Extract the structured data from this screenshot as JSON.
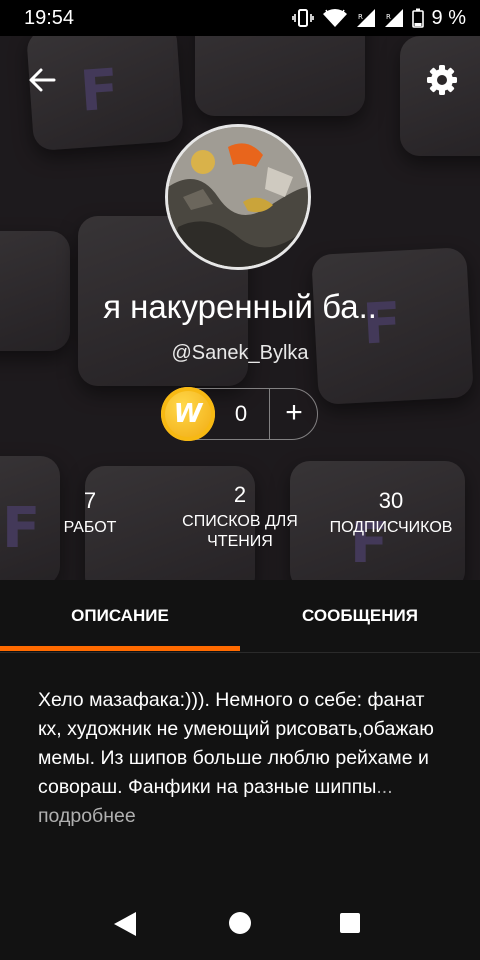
{
  "status_bar": {
    "time": "19:54",
    "battery": "9 %"
  },
  "profile": {
    "display_name": "я накуренный ба..",
    "username": "@Sanek_Bylka",
    "coins": "0",
    "coin_letter": "W",
    "add_label": "+"
  },
  "stats": [
    {
      "value": "7",
      "label": "РАБОТ"
    },
    {
      "value": "2",
      "label": "СПИСКОВ ДЛЯ ЧТЕНИЯ"
    },
    {
      "value": "30",
      "label": "ПОДПИСЧИКОВ"
    }
  ],
  "tabs": [
    {
      "label": "ОПИСАНИЕ",
      "active": true
    },
    {
      "label": "СООБЩЕНИЯ",
      "active": false
    }
  ],
  "description": {
    "text": "Хело мазафака:))). Немного о себе: фанат кх, художник не умеющий рисовать,обажаю мемы. Из шипов больше люблю рейхаме и совораш. Фанфики на разные шиппы",
    "ellipsis": "...",
    "more_label": " подробнее"
  },
  "header_bg": {
    "key_letter": "F",
    "key_letter_color": "#5c4f7e"
  },
  "colors": {
    "accent": "#ff6a00",
    "background": "#121212",
    "coin": "#f7b913"
  },
  "icons": {
    "back": "arrow-left-icon",
    "settings": "gear-icon",
    "coin": "wattpad-coin-icon",
    "nav_back": "triangle-back-icon",
    "nav_home": "circle-home-icon",
    "nav_recent": "square-recents-icon"
  }
}
